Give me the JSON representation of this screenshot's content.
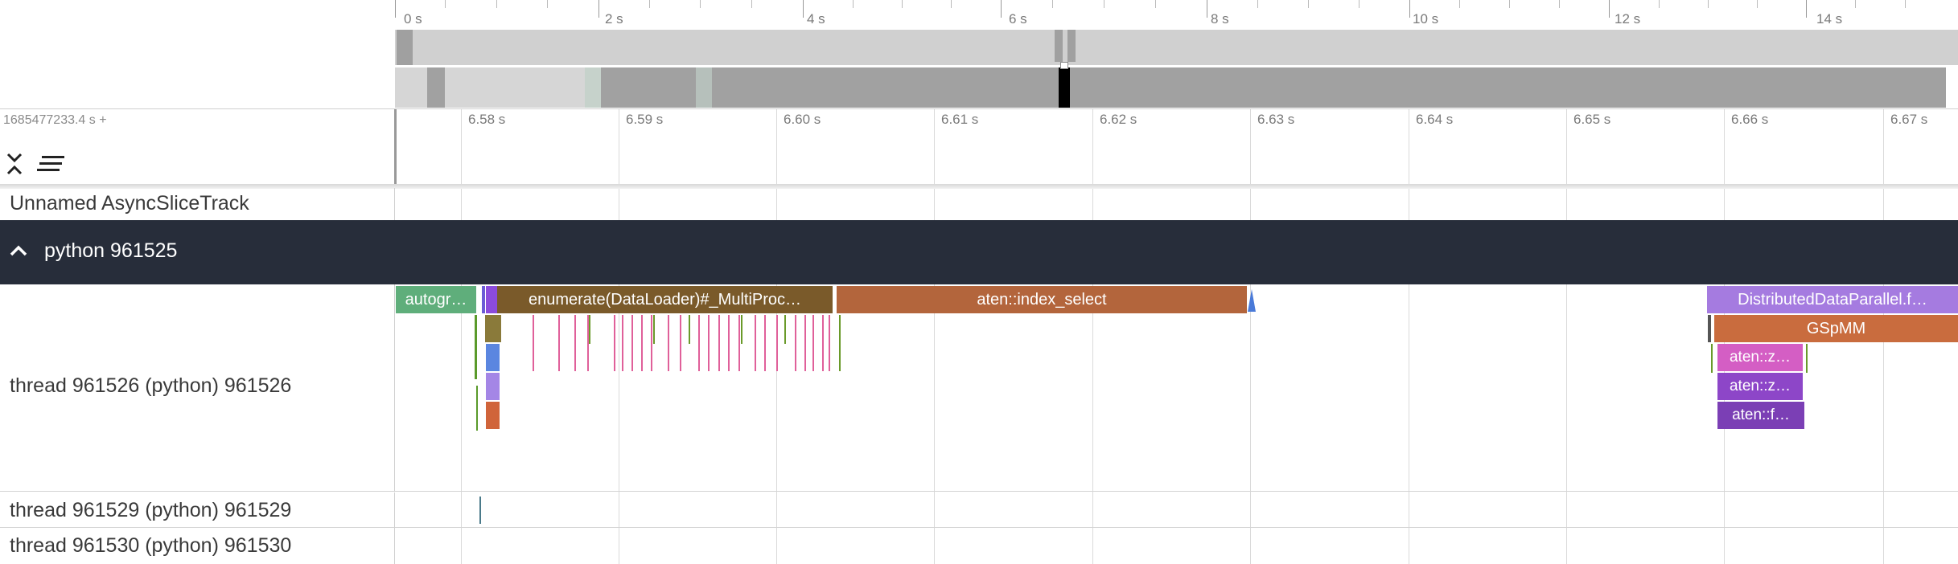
{
  "overview": {
    "ticks": [
      "0 s",
      "2 s",
      "4 s",
      "6 s",
      "8 s",
      "10 s",
      "12 s",
      "14 s"
    ]
  },
  "timeline": {
    "base_label": "1685477233.4 s +",
    "ticks": [
      "6.58 s",
      "6.59 s",
      "6.60 s",
      "6.61 s",
      "6.62 s",
      "6.63 s",
      "6.64 s",
      "6.65 s",
      "6.66 s",
      "6.67 s"
    ]
  },
  "tracks": {
    "async_track": "Unnamed AsyncSliceTrack",
    "process_group": "python 961525",
    "thread_1": "thread 961526 (python) 961526",
    "thread_2": "thread 961529 (python) 961529",
    "thread_3": "thread 961530 (python) 961530"
  },
  "slices": {
    "autograd": "autogr…",
    "enumerate": "enumerate(DataLoader)#_MultiProc…",
    "index_select": "aten::index_select",
    "ddp": "DistributedDataParallel.f…",
    "gspmm": "GSpMM",
    "aten_z1": "aten::z…",
    "aten_z2": "aten::z…",
    "aten_f": "aten::f…"
  },
  "colors": {
    "header_dark": "#272d3a",
    "autograd": "#5fae7b",
    "enumerate": "#7a5a2a",
    "index_select": "#b3653c",
    "ddp": "#a57be0",
    "gspmm": "#c96c3e",
    "aten_z1": "#d45ec4",
    "aten_z2": "#8d46c8",
    "aten_f": "#7b3fb5"
  },
  "icons": {
    "collapse": "collapse-all-icon",
    "sort": "sort-lines-icon",
    "expand": "chevron-up-icon"
  }
}
